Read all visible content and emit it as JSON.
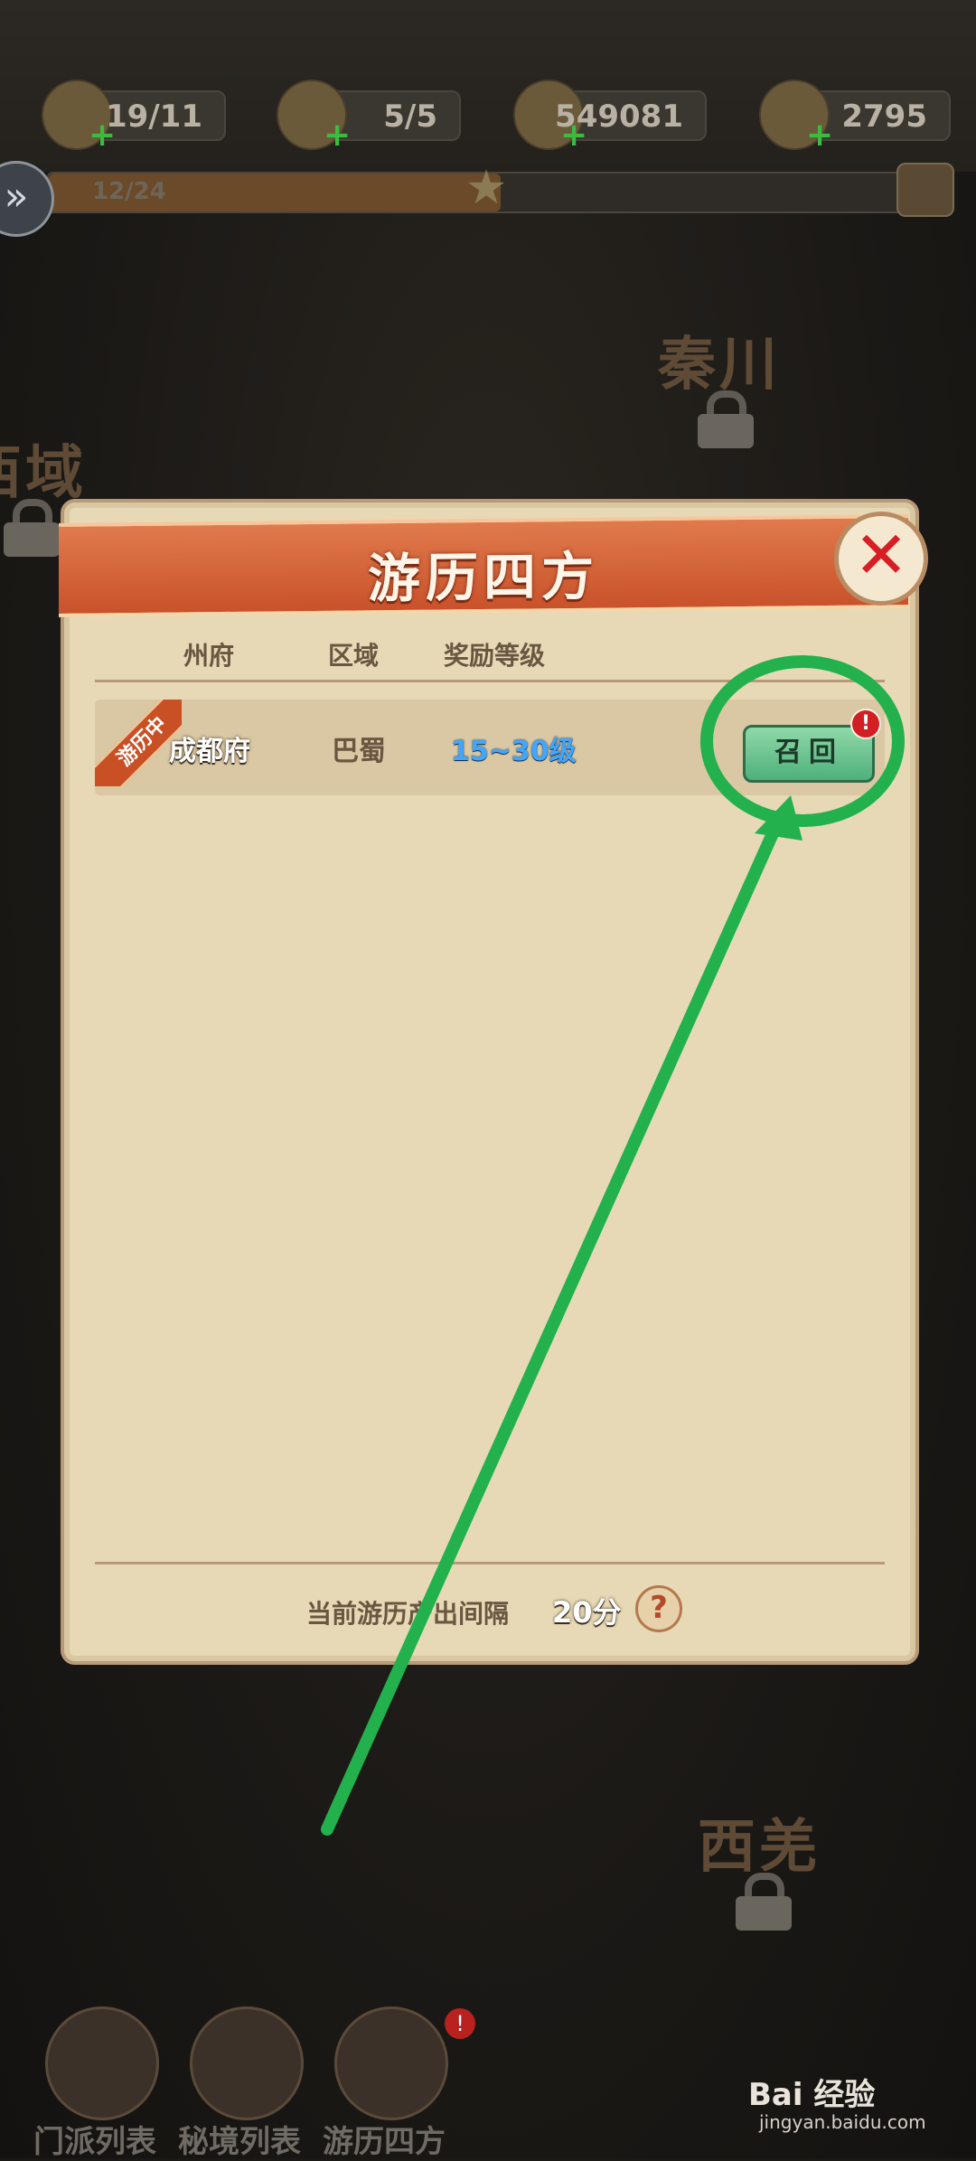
{
  "resources": [
    {
      "icon": "gear-icon",
      "value": "19/11"
    },
    {
      "icon": "scroll-icon",
      "value": "5/5"
    },
    {
      "icon": "coin-icon",
      "value": "549081"
    },
    {
      "icon": "gold-ingot-icon",
      "value": "2795"
    }
  ],
  "progress": {
    "text": "12/24",
    "fraction": 0.5
  },
  "map_labels": {
    "qinchuan": "秦川",
    "xiyu": "西域",
    "xiqiang": "西羌"
  },
  "dialog": {
    "title": "游历四方",
    "columns": {
      "zhoufu": "州府",
      "quyu": "区域",
      "level": "奖励等级"
    },
    "rows": [
      {
        "badge": "游历中",
        "city": "成都府",
        "region": "巴蜀",
        "level": "15~30级",
        "button": "召回",
        "alert": "!"
      }
    ],
    "footer": {
      "label": "当前游历产出间隔",
      "value": "20分",
      "help": "?"
    }
  },
  "bottom_nav": [
    {
      "label": "门派列表"
    },
    {
      "label": "秘境列表"
    },
    {
      "label": "游历四方",
      "badge": "!"
    }
  ],
  "watermark": {
    "brand": "Bai 经验",
    "sub": "jingyan.baidu.com"
  },
  "colors": {
    "accent_orange": "#d9602f",
    "button_green": "#4fb07b",
    "annotation_green": "#22b14c",
    "alert_red": "#d11f24"
  }
}
